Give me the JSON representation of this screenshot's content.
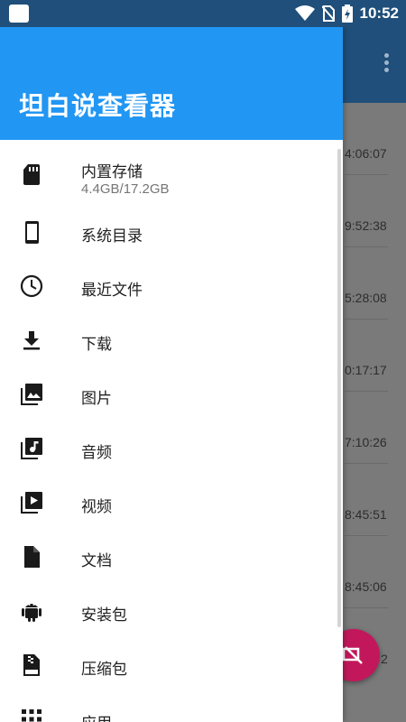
{
  "status_bar": {
    "time": "10:52"
  },
  "drawer": {
    "title": "坦白说查看器",
    "items": [
      {
        "label": "内置存储",
        "sub": "4.4GB/17.2GB",
        "icon": "sd-card-icon"
      },
      {
        "label": "系统目录",
        "icon": "phone-icon"
      },
      {
        "label": "最近文件",
        "icon": "clock-icon"
      },
      {
        "label": "下载",
        "icon": "download-icon"
      },
      {
        "label": "图片",
        "icon": "image-icon"
      },
      {
        "label": "音频",
        "icon": "music-library-icon"
      },
      {
        "label": "视频",
        "icon": "video-library-icon"
      },
      {
        "label": "文档",
        "icon": "document-icon"
      },
      {
        "label": "安装包",
        "icon": "android-icon"
      },
      {
        "label": "压缩包",
        "icon": "archive-icon"
      },
      {
        "label": "应用",
        "icon": "apps-grid-icon"
      }
    ]
  },
  "background_list": {
    "times": [
      "4:06:07",
      "9:52:38",
      "5:28:08",
      "0:17:17",
      "7:10:26",
      "8:45:51",
      "8:45:06",
      "2"
    ]
  },
  "colors": {
    "header": "#2196f3",
    "appbar": "#1f4f7a",
    "fab": "#c2185b"
  }
}
